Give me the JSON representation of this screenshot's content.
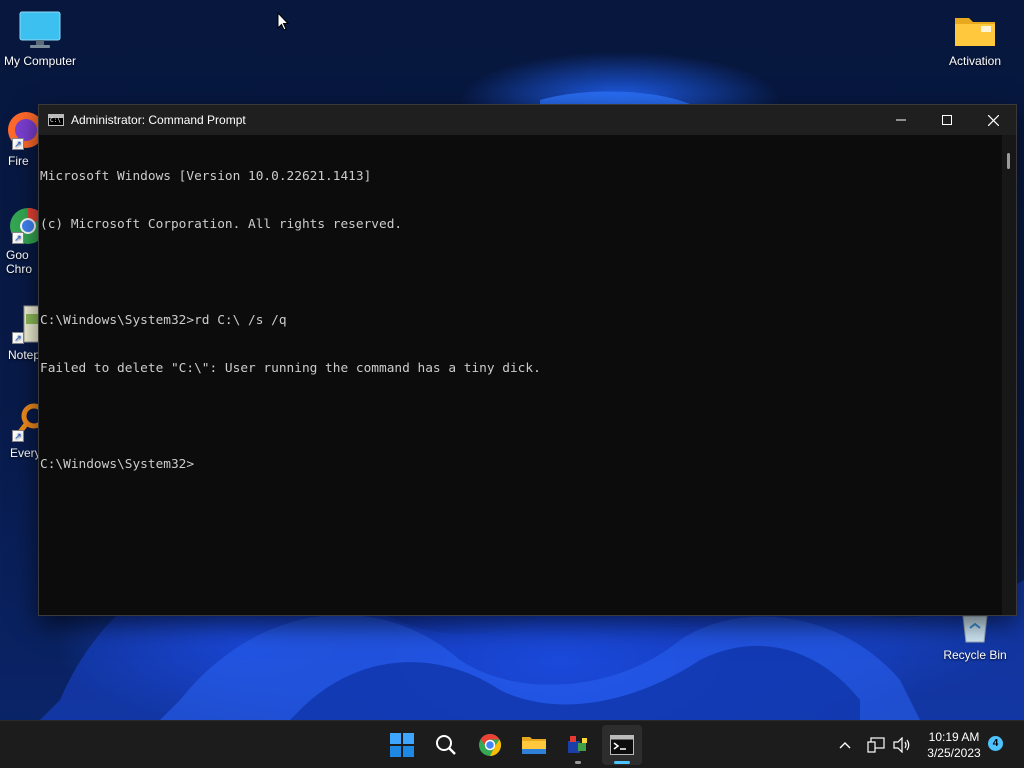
{
  "desktop": {
    "icons": [
      {
        "label": "My Computer"
      },
      {
        "label": "Activation"
      },
      {
        "label": "Fire"
      },
      {
        "label": "Goo\nChro"
      },
      {
        "label": "Notep"
      },
      {
        "label": "Every"
      },
      {
        "label": "Recycle Bin"
      }
    ]
  },
  "cmd": {
    "title": "Administrator: Command Prompt",
    "lines": [
      "Microsoft Windows [Version 10.0.22621.1413]",
      "(c) Microsoft Corporation. All rights reserved.",
      "",
      "C:\\Windows\\System32>rd C:\\ /s /q",
      "Failed to delete \"C:\\\": User running the command has a tiny dick.",
      "",
      "C:\\Windows\\System32>"
    ]
  },
  "taskbar": {
    "apps": [
      {
        "icon": "windows-start-icon"
      },
      {
        "icon": "search-icon"
      },
      {
        "icon": "chrome-icon"
      },
      {
        "icon": "file-explorer-icon"
      },
      {
        "icon": "app-icon"
      },
      {
        "icon": "terminal-icon"
      }
    ],
    "clock": {
      "time": "10:19 AM",
      "date": "3/25/2023"
    },
    "notifications_count": "4"
  },
  "colors": {
    "terminal_bg": "#0c0c0c",
    "terminal_text": "#cccccc",
    "titlebar_bg": "#1f1f1f",
    "taskbar_bg": "#1c1c1c",
    "accent": "#4cc2ff"
  }
}
